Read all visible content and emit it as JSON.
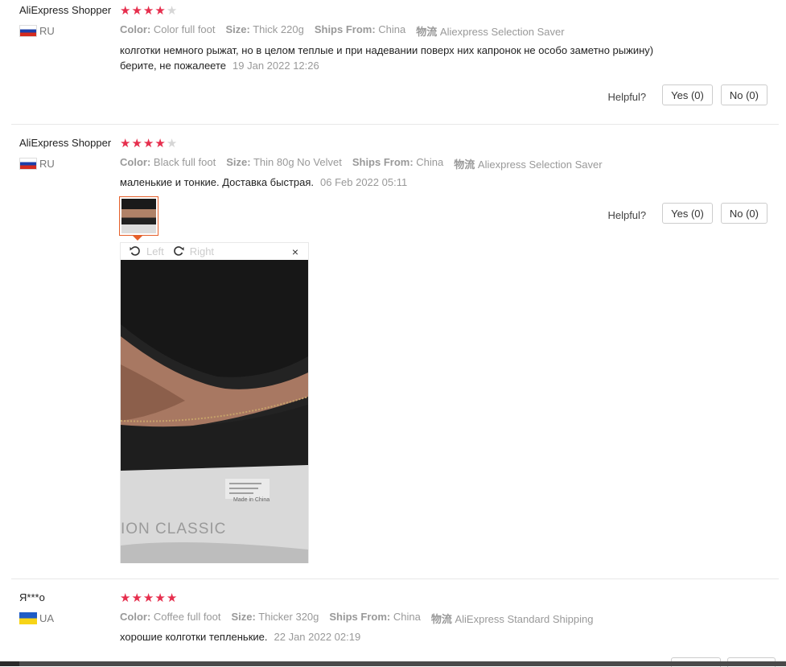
{
  "reviews": [
    {
      "user": "AliExpress Shopper",
      "country": "RU",
      "rating": 4,
      "attrs": [
        {
          "key": "Color:",
          "value": "Color full foot"
        },
        {
          "key": "Size:",
          "value": "Thick 220g"
        },
        {
          "key": "Ships From:",
          "value": "China"
        },
        {
          "key": "物流",
          "value": "Aliexpress Selection Saver"
        }
      ],
      "text_line1": "колготки немного рыжат, но в целом теплые и при надевании поверх них капронок не особо заметно рыжину)",
      "text_line2": "берите, не пожалеете",
      "date": "19 Jan 2022 12:26",
      "helpful_label": "Helpful?",
      "yes_label": "Yes (0)",
      "no_label": "No (0)"
    },
    {
      "user": "AliExpress Shopper",
      "country": "RU",
      "rating": 4,
      "attrs": [
        {
          "key": "Color:",
          "value": "Black full foot"
        },
        {
          "key": "Size:",
          "value": "Thin 80g No Velvet"
        },
        {
          "key": "Ships From:",
          "value": "China"
        },
        {
          "key": "物流",
          "value": "Aliexpress Selection Saver"
        }
      ],
      "text": "маленькие и тонкие. Доставка быстрая.",
      "date": "06 Feb 2022 05:11",
      "helpful_label": "Helpful?",
      "yes_label": "Yes (0)",
      "no_label": "No (0)",
      "viewer": {
        "left_label": "Left",
        "right_label": "Right",
        "close_label": "×",
        "photo_text": "ION CLASSIC",
        "package_text": "Made in China"
      }
    },
    {
      "user": "Я***о",
      "country": "UA",
      "rating": 5,
      "attrs": [
        {
          "key": "Color:",
          "value": "Coffee full foot"
        },
        {
          "key": "Size:",
          "value": "Thicker 320g"
        },
        {
          "key": "Ships From:",
          "value": "China"
        },
        {
          "key": "物流",
          "value": "AliExpress Standard Shipping"
        }
      ],
      "text": "хорошие колготки тепленькие.",
      "date": "22 Jan 2022 02:19"
    }
  ],
  "colors": {
    "star_on": "#e62e4d",
    "star_off": "#d6d6d6",
    "thumb_border": "#e55f2a"
  }
}
